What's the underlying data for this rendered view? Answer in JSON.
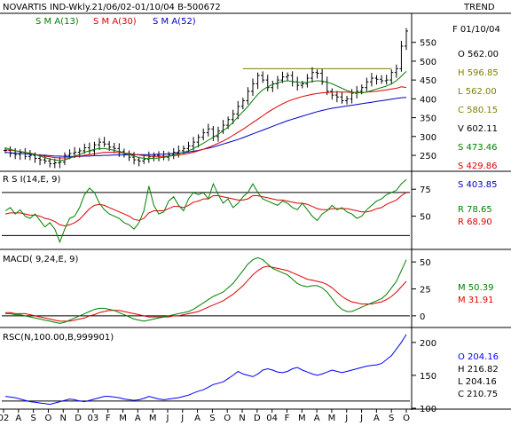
{
  "header": {
    "title": "NOVARTIS IND-Wkly.21/06/02-01/10/04  B-500672",
    "trend": "TREND"
  },
  "colors": {
    "price": "#000000",
    "sma13": "#008000",
    "sma30": "#e00000",
    "sma52": "#0000c0",
    "resistance": "#808000",
    "rsi_main": "#008000",
    "rsi_signal": "#e00000",
    "rsc": "#0000ff"
  },
  "chart_data": [
    {
      "type": "line",
      "panel": "price",
      "legend": [
        {
          "label": "S M A(13)",
          "color": "#008000"
        },
        {
          "label": "S M A(30)",
          "color": "#e00000"
        },
        {
          "label": "S M A(52)",
          "color": "#0000c0"
        }
      ],
      "date_label": "F 01/10/04",
      "readout": [
        {
          "text": "O  562.00",
          "color": "#000000"
        },
        {
          "text": "H  596.85",
          "color": "#808000"
        },
        {
          "text": "L  562.00",
          "color": "#808000"
        },
        {
          "text": "C  580.15",
          "color": "#808000"
        },
        {
          "text": "V  602.11",
          "color": "#000000"
        },
        {
          "text": "S  473.46",
          "color": "#008000"
        },
        {
          "text": "S  429.86",
          "color": "#e00000"
        },
        {
          "text": "S  403.85",
          "color": "#0000c0"
        }
      ],
      "ylim": [
        210,
        620
      ],
      "yticks": [
        250,
        300,
        350,
        400,
        450,
        500,
        550
      ],
      "ohlc_close_approx": [
        263,
        255,
        252,
        258,
        247,
        250,
        242,
        238,
        235,
        228,
        230,
        232,
        250,
        255,
        258,
        262,
        270,
        262,
        278,
        285,
        280,
        272,
        268,
        260,
        252,
        245,
        238,
        235,
        240,
        246,
        250,
        248,
        245,
        252,
        258,
        262,
        268,
        275,
        285,
        298,
        310,
        320,
        300,
        315,
        330,
        345,
        360,
        380,
        395,
        420,
        440,
        462,
        450,
        430,
        440,
        450,
        458,
        462,
        445,
        436,
        440,
        455,
        470,
        468,
        445,
        420,
        410,
        405,
        395,
        400,
        415,
        420,
        430,
        445,
        455,
        452,
        448,
        450,
        470,
        480,
        540,
        580
      ],
      "sma13_approx": [
        270,
        266,
        262,
        260,
        258,
        255,
        252,
        248,
        244,
        240,
        238,
        236,
        238,
        242,
        248,
        252,
        258,
        262,
        266,
        268,
        268,
        266,
        263,
        260,
        256,
        252,
        248,
        244,
        242,
        241,
        242,
        243,
        245,
        247,
        250,
        254,
        258,
        262,
        268,
        275,
        282,
        290,
        298,
        306,
        315,
        325,
        338,
        352,
        366,
        380,
        396,
        412,
        424,
        432,
        438,
        442,
        446,
        448,
        446,
        444,
        443,
        444,
        446,
        448,
        447,
        444,
        440,
        434,
        428,
        422,
        418,
        416,
        416,
        418,
        422,
        426,
        430,
        434,
        440,
        448,
        460,
        473
      ],
      "sma30_approx": [
        265,
        264,
        262,
        260,
        258,
        256,
        253,
        250,
        248,
        246,
        244,
        243,
        243,
        244,
        246,
        248,
        250,
        252,
        254,
        256,
        258,
        258,
        258,
        257,
        256,
        255,
        253,
        251,
        249,
        248,
        247,
        247,
        247,
        248,
        249,
        251,
        253,
        255,
        258,
        262,
        266,
        271,
        276,
        282,
        288,
        295,
        303,
        311,
        319,
        328,
        337,
        346,
        355,
        364,
        372,
        380,
        387,
        393,
        398,
        402,
        406,
        409,
        412,
        414,
        416,
        417,
        418,
        418,
        418,
        418,
        417,
        417,
        417,
        418,
        419,
        420,
        422,
        424,
        426,
        428,
        432,
        430
      ],
      "sma52_approx": [
        258,
        257,
        256,
        255,
        254,
        253,
        252,
        251,
        250,
        249,
        248,
        248,
        247,
        247,
        247,
        247,
        248,
        248,
        249,
        249,
        250,
        250,
        251,
        251,
        251,
        252,
        252,
        252,
        252,
        252,
        252,
        253,
        253,
        254,
        255,
        256,
        257,
        259,
        261,
        263,
        266,
        269,
        272,
        276,
        280,
        284,
        288,
        292,
        297,
        302,
        307,
        312,
        317,
        322,
        327,
        332,
        337,
        342,
        346,
        350,
        354,
        358,
        362,
        366,
        369,
        372,
        375,
        377,
        379,
        381,
        383,
        385,
        387,
        389,
        391,
        393,
        395,
        397,
        399,
        401,
        403,
        404
      ],
      "annotations": [
        "resistance line near 480"
      ]
    },
    {
      "type": "line",
      "panel": "rsi",
      "title": "R S I(14,E, 9)",
      "readout": [
        {
          "text": "R  78.65",
          "color": "#008000"
        },
        {
          "text": "R  68.90",
          "color": "#e00000"
        }
      ],
      "ylim": [
        20,
        90
      ],
      "yticks": [
        50,
        75
      ],
      "reference_lines": [
        72,
        32
      ],
      "series": [
        {
          "values": [
            55,
            58,
            52,
            56,
            50,
            48,
            52,
            46,
            40,
            44,
            38,
            26,
            38,
            48,
            50,
            58,
            70,
            76,
            72,
            62,
            56,
            52,
            50,
            48,
            44,
            42,
            38,
            44,
            55,
            78,
            60,
            52,
            54,
            64,
            68,
            60,
            55,
            66,
            72,
            70,
            72,
            66,
            80,
            70,
            62,
            66,
            58,
            62,
            68,
            72,
            80,
            72,
            66,
            64,
            62,
            60,
            64,
            62,
            58,
            56,
            62,
            56,
            50,
            46,
            52,
            55,
            60,
            56,
            58,
            54,
            52,
            48,
            50,
            56,
            60,
            64,
            66,
            70,
            72,
            74,
            80,
            84
          ]
        },
        {
          "values": [
            52,
            53,
            53,
            53,
            52,
            51,
            51,
            50,
            48,
            47,
            45,
            42,
            41,
            42,
            44,
            47,
            52,
            57,
            60,
            61,
            60,
            58,
            56,
            54,
            52,
            50,
            47,
            46,
            48,
            53,
            55,
            55,
            55,
            57,
            59,
            59,
            58,
            60,
            63,
            64,
            66,
            66,
            69,
            69,
            68,
            67,
            66,
            65,
            65,
            66,
            69,
            69,
            68,
            67,
            66,
            65,
            65,
            64,
            63,
            62,
            62,
            61,
            59,
            57,
            56,
            56,
            57,
            57,
            57,
            57,
            56,
            55,
            54,
            54,
            55,
            57,
            58,
            61,
            63,
            65,
            69,
            72
          ]
        }
      ]
    },
    {
      "type": "line",
      "panel": "macd",
      "title": "MACD( 9,24,E, 9)",
      "readout": [
        {
          "text": "M  50.39",
          "color": "#008000"
        },
        {
          "text": "M  31.91",
          "color": "#e00000"
        }
      ],
      "ylim": [
        -10,
        60
      ],
      "yticks": [
        0,
        25,
        50
      ],
      "reference_lines": [
        0
      ],
      "series": [
        {
          "values": [
            2,
            2,
            1,
            1,
            0,
            -1,
            -2,
            -3,
            -4,
            -5,
            -6,
            -7,
            -6,
            -4,
            -2,
            0,
            2,
            4,
            6,
            7,
            7,
            6,
            5,
            3,
            1,
            -1,
            -3,
            -4,
            -5,
            -4,
            -3,
            -2,
            -1,
            0,
            1,
            2,
            3,
            4,
            6,
            9,
            12,
            15,
            18,
            20,
            22,
            26,
            30,
            36,
            42,
            48,
            52,
            54,
            52,
            48,
            44,
            42,
            40,
            38,
            34,
            30,
            28,
            27,
            28,
            28,
            26,
            22,
            16,
            10,
            6,
            4,
            4,
            6,
            8,
            10,
            12,
            14,
            16,
            20,
            26,
            32,
            42,
            52
          ]
        },
        {
          "values": [
            3,
            3,
            2,
            2,
            2,
            1,
            0,
            -1,
            -2,
            -3,
            -4,
            -5,
            -5,
            -5,
            -4,
            -3,
            -2,
            0,
            1,
            3,
            4,
            5,
            5,
            5,
            4,
            3,
            2,
            1,
            0,
            -1,
            -1,
            -1,
            -1,
            -1,
            0,
            0,
            1,
            2,
            3,
            4,
            6,
            8,
            10,
            12,
            14,
            17,
            20,
            24,
            28,
            33,
            38,
            42,
            45,
            46,
            45,
            44,
            43,
            42,
            40,
            38,
            36,
            34,
            33,
            32,
            31,
            29,
            26,
            22,
            18,
            15,
            13,
            12,
            11,
            11,
            11,
            12,
            13,
            15,
            18,
            22,
            27,
            32
          ]
        }
      ]
    },
    {
      "type": "line",
      "panel": "rsc",
      "title": "RSC(N,100.00,B,999901)",
      "readout": [
        {
          "text": "O  204.16",
          "color": "#0000ff"
        },
        {
          "text": "H  216.82",
          "color": "#000000"
        },
        {
          "text": "L  204.16",
          "color": "#000000"
        },
        {
          "text": "C  210.75",
          "color": "#000000"
        }
      ],
      "ylim": [
        100,
        220
      ],
      "yticks": [
        100,
        150,
        200
      ],
      "reference_lines": [
        111
      ],
      "values": [
        118,
        117,
        116,
        114,
        112,
        110,
        109,
        108,
        107,
        106,
        108,
        110,
        112,
        114,
        113,
        111,
        110,
        112,
        114,
        116,
        118,
        118,
        117,
        116,
        114,
        113,
        112,
        113,
        115,
        118,
        116,
        114,
        113,
        114,
        115,
        116,
        118,
        120,
        123,
        126,
        128,
        132,
        136,
        138,
        140,
        145,
        150,
        156,
        152,
        150,
        148,
        152,
        158,
        160,
        158,
        155,
        154,
        156,
        160,
        162,
        158,
        155,
        152,
        150,
        152,
        155,
        158,
        156,
        154,
        156,
        158,
        160,
        162,
        164,
        165,
        166,
        168,
        174,
        180,
        190,
        200,
        212
      ]
    }
  ],
  "x_axis": {
    "labels": [
      "02",
      "A",
      "S",
      "O",
      "N",
      "D",
      "03",
      "F",
      "M",
      "A",
      "M",
      "J",
      "J",
      "A",
      "S",
      "O",
      "N",
      "D",
      "04",
      "F",
      "M",
      "A",
      "M",
      "J",
      "J",
      "A",
      "S",
      "O"
    ]
  }
}
